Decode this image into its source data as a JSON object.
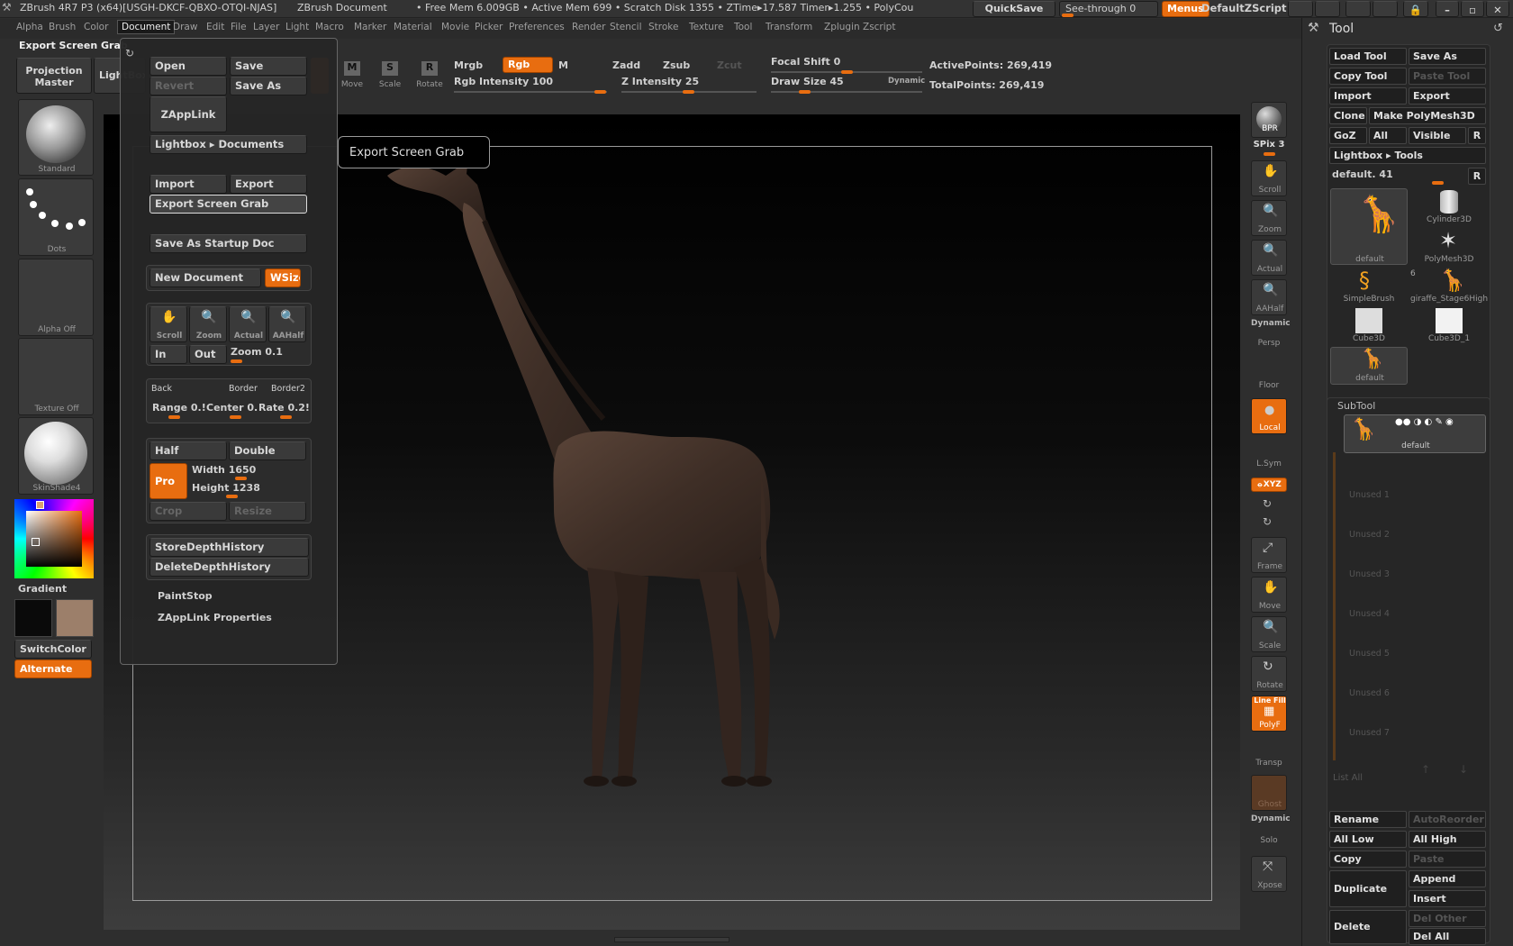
{
  "titlebar": {
    "app": "ZBrush 4R7 P3 (x64)[USGH-DKCF-QBXO-OTQI-NJAS]",
    "doc": "ZBrush Document",
    "stats": "• Free Mem 6.009GB • Active Mem 699 • Scratch Disk 1355 • ZTime▸17.587 Timer▸1.255 • PolyCou",
    "quicksave": "QuickSave",
    "seethrough": "See-through  0",
    "menus": "Menus",
    "zscript": "DefaultZScript"
  },
  "menubar": [
    "Alpha",
    "Brush",
    "Color",
    "Document",
    "Draw",
    "Edit",
    "File",
    "Layer",
    "Light",
    "Macro",
    "Marker",
    "Material",
    "Movie",
    "Picker",
    "Preferences",
    "Render",
    "Stencil",
    "Stroke",
    "Texture",
    "Tool",
    "Transform",
    "Zplugin",
    "Zscript"
  ],
  "menubar_active": "Document",
  "hint_left": "Export Screen Grab",
  "tooltip": "Export Screen Grab",
  "topbar": {
    "projection_master": "Projection Master",
    "lightbox": "LightBox",
    "move": "Move",
    "scale": "Scale",
    "rotate": "Rotate",
    "mrgb": "Mrgb",
    "rgb": "Rgb",
    "m": "M",
    "zadd": "Zadd",
    "zsub": "Zsub",
    "zcut": "Zcut",
    "rgb_intensity": "Rgb Intensity 100",
    "z_intensity": "Z Intensity 25",
    "focal_shift": "Focal Shift 0",
    "draw_size": "Draw Size 45",
    "dynamic": "Dynamic",
    "active_points": "ActivePoints: 269,419",
    "total_points": "TotalPoints: 269,419"
  },
  "left_shelf": {
    "brush": "Standard",
    "stroke": "Dots",
    "alpha": "Alpha  Off",
    "texture": "Texture  Off",
    "material": "SkinShade4",
    "gradient": "Gradient",
    "switchcolor": "SwitchColor",
    "alternate": "Alternate",
    "main_color": "#0a0a0a",
    "secondary_color": "#9c7f6a"
  },
  "document_menu": {
    "open": "Open",
    "save": "Save",
    "revert": "Revert",
    "save_as": "Save As",
    "zapplink": "ZAppLink",
    "lightbox_docs": "Lightbox ▸ Documents",
    "import": "Import",
    "export": "Export",
    "export_screen_grab": "Export Screen Grab",
    "save_startup": "Save As Startup Doc",
    "new_document": "New Document",
    "wsize": "WSize",
    "scroll": "Scroll",
    "zoom": "Zoom",
    "actual": "Actual",
    "aahalf": "AAHalf",
    "in": "In",
    "out": "Out",
    "zoom_value": "Zoom 0.1",
    "back": "Back",
    "border": "Border",
    "border2": "Border2",
    "range": "Range 0.!",
    "center": "Center 0.",
    "rate": "Rate 0.2!",
    "half": "Half",
    "double": "Double",
    "pro": "Pro",
    "width": "Width 1650",
    "height": "Height 1238",
    "crop": "Crop",
    "resize": "Resize",
    "store_depth": "StoreDepthHistory",
    "delete_depth": "DeleteDepthHistory",
    "paintstop": "PaintStop",
    "zapplink_props": "ZAppLink Properties"
  },
  "right_shelf": {
    "bpr": "BPR",
    "spix": "SPix 3",
    "scroll": "Scroll",
    "zoom": "Zoom",
    "actual": "Actual",
    "aahalf": "AAHalf",
    "dynamic": "Dynamic",
    "persp": "Persp",
    "floor": "Floor",
    "local": "Local",
    "lsym": "L.Sym",
    "xyz": "⦵XYZ",
    "frame": "Frame",
    "move": "Move",
    "scale": "Scale",
    "rotate": "Rotate",
    "linefill": "Line Fill",
    "polyf": "PolyF",
    "transp": "Transp",
    "ghost": "Ghost",
    "dynamic2": "Dynamic",
    "solo": "Solo",
    "xpose": "Xpose"
  },
  "tool_palette": {
    "title": "Tool",
    "load_tool": "Load Tool",
    "save_as": "Save As",
    "copy_tool": "Copy Tool",
    "paste_tool": "Paste Tool",
    "import": "Import",
    "export": "Export",
    "clone": "Clone",
    "make_polymesh": "Make PolyMesh3D",
    "goz": "GoZ",
    "all": "All",
    "visible": "Visible",
    "r": "R",
    "lightbox_tools": "Lightbox ▸ Tools",
    "current_tool": "default. 41",
    "tools": [
      {
        "name": "default"
      },
      {
        "name": "Cylinder3D"
      },
      {
        "name": "PolyMesh3D"
      },
      {
        "name": "SimpleBrush"
      },
      {
        "name": "giraffe_Stage6High"
      },
      {
        "name": "Cube3D"
      },
      {
        "name": "Cube3D_1"
      },
      {
        "name": "default"
      }
    ],
    "tool_count": "6",
    "subtool_header": "SubTool",
    "subtool_active": "default",
    "unused": [
      "Unused 1",
      "Unused 2",
      "Unused 3",
      "Unused 4",
      "Unused 5",
      "Unused 6",
      "Unused 7"
    ],
    "list_all": "List  All",
    "rename": "Rename",
    "autoreorder": "AutoReorder",
    "all_low": "All Low",
    "all_high": "All High",
    "copy": "Copy",
    "paste": "Paste",
    "duplicate": "Duplicate",
    "append": "Append",
    "insert": "Insert",
    "delete": "Delete",
    "del_other": "Del Other",
    "del_all": "Del All"
  }
}
